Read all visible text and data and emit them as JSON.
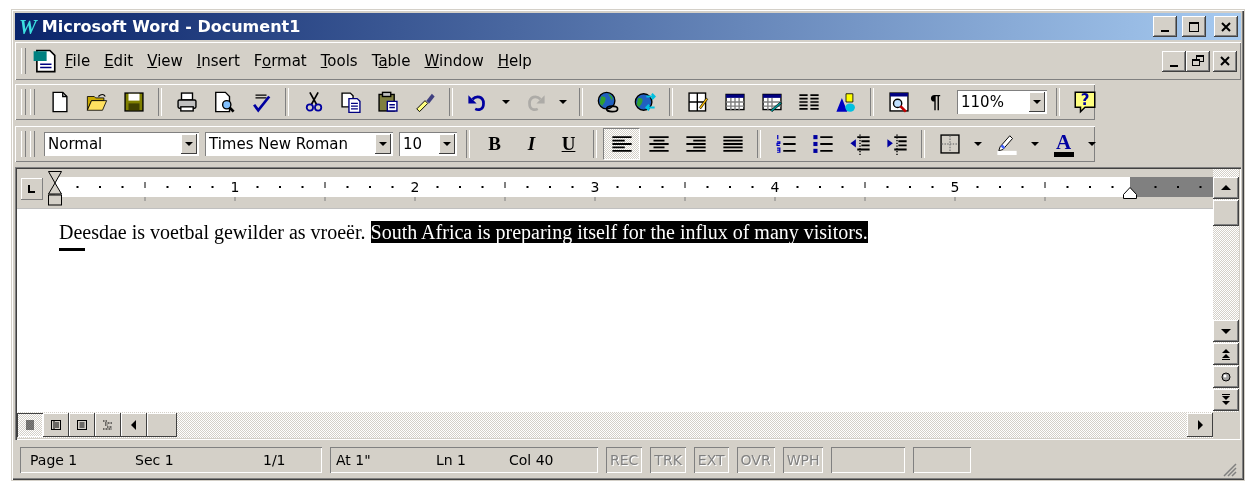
{
  "window": {
    "icon_text": "W",
    "title": "Microsoft Word - Document1"
  },
  "menu": [
    {
      "key": "F",
      "post": "ile"
    },
    {
      "key": "E",
      "post": "dit"
    },
    {
      "key": "V",
      "post": "iew"
    },
    {
      "key": "I",
      "post": "nsert"
    },
    {
      "pre": "F",
      "key": "o",
      "post": "rmat"
    },
    {
      "key": "T",
      "post": "ools"
    },
    {
      "pre": "T",
      "key": "a",
      "post": "ble"
    },
    {
      "key": "W",
      "post": "indow"
    },
    {
      "key": "H",
      "post": "elp"
    }
  ],
  "standard_toolbar": {
    "undo": {
      "disabled": false
    },
    "redo": {
      "disabled": true
    },
    "show_hide": "¶",
    "zoom": "110%",
    "help": "?"
  },
  "formatting_toolbar": {
    "style": "Normal",
    "font": "Times New Roman",
    "size": "10",
    "emphasis": [
      {
        "kind": "bold",
        "label": "B",
        "selected": false
      },
      {
        "kind": "italic",
        "label": "I",
        "selected": false
      },
      {
        "kind": "underline",
        "label": "U",
        "selected": false
      }
    ],
    "alignment": [
      {
        "kind": "left",
        "selected": true
      },
      {
        "kind": "center",
        "selected": false
      },
      {
        "kind": "right",
        "selected": false
      },
      {
        "kind": "justify",
        "selected": false
      }
    ],
    "font_color": {
      "label": "A"
    }
  },
  "ruler": {
    "numbers": [
      "1",
      "2",
      "3",
      "4",
      "5"
    ]
  },
  "document": {
    "runs": [
      {
        "text": "Deesdae is voetbal gewilder as vroeër. ",
        "selected": false
      },
      {
        "text": "South Africa is preparing itself for the influx of many visitors.",
        "selected": true
      }
    ]
  },
  "view_buttons": [
    {
      "kind": "normal",
      "selected": true
    },
    {
      "kind": "web",
      "selected": false
    },
    {
      "kind": "print",
      "selected": false
    },
    {
      "kind": "outline",
      "selected": false
    }
  ],
  "status_bar": {
    "page": "Page 1",
    "section": "Sec 1",
    "pages": "1/1",
    "at": "At 1\"",
    "line": "Ln 1",
    "column": "Col 40",
    "modes": [
      {
        "label": "REC",
        "disabled": true
      },
      {
        "label": "TRK",
        "disabled": true
      },
      {
        "label": "EXT",
        "disabled": true
      },
      {
        "label": "OVR",
        "disabled": true
      },
      {
        "label": "WPH",
        "disabled": true
      }
    ]
  }
}
